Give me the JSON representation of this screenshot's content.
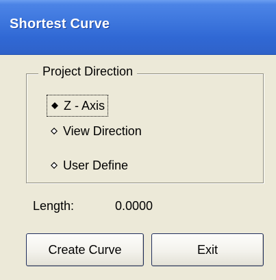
{
  "window": {
    "title": "Shortest Curve"
  },
  "project_direction": {
    "legend": "Project Direction",
    "options": [
      {
        "label": "Z - Axis",
        "selected": true
      },
      {
        "label": "View Direction",
        "selected": false
      },
      {
        "label": "User Define",
        "selected": false
      }
    ]
  },
  "length": {
    "label": "Length:",
    "value": "0.0000"
  },
  "buttons": {
    "create_label": "Create Curve",
    "exit_label": "Exit"
  },
  "colors": {
    "titlebar": "#3b74dc",
    "title_text": "#ffffff",
    "window_bg": "#ece9d8"
  }
}
